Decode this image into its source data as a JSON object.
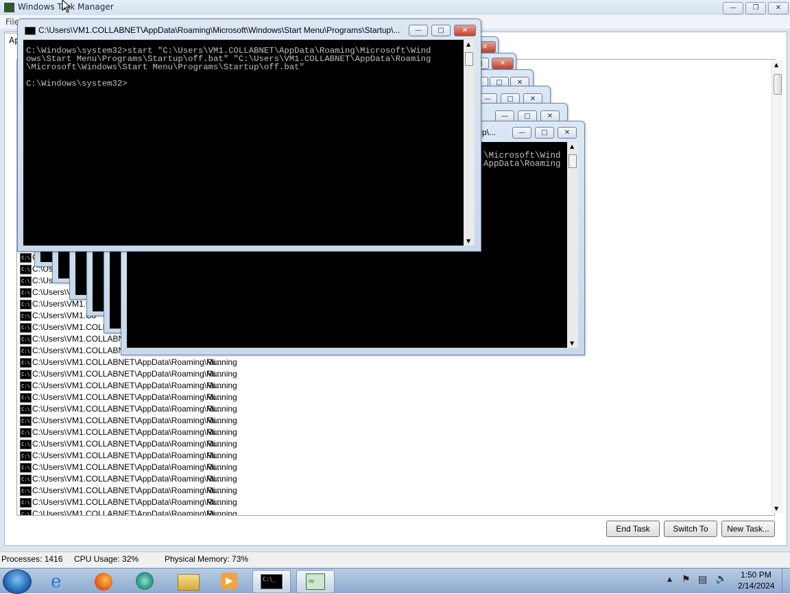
{
  "task_manager": {
    "title": "Windows Task Manager",
    "menu_file": "File",
    "tab_applications": "Ap",
    "buttons": {
      "end_task": "End Task",
      "switch_to": "Switch To",
      "new_task": "New Task..."
    },
    "status": {
      "processes": "Processes: 1416",
      "cpu": "CPU Usage: 32%",
      "memory": "Physical Memory: 73%"
    },
    "rows_partial": [
      "C",
      "C:\\Us",
      "C:\\Us",
      "C:\\Users\\Vi",
      "C:\\Users\\VM1.C",
      "C:\\Users\\VM1.Co",
      "C:\\Users\\VM1.COLLAE",
      "C:\\Users\\VM1.COLLABNE",
      "C:\\Users\\VM1.COLLABNET"
    ],
    "rows_full": [
      {
        "name": "C:\\Users\\VM1.COLLABNET\\AppData\\Roaming\\Mi...",
        "status": "Running"
      },
      {
        "name": "C:\\Users\\VM1.COLLABNET\\AppData\\Roaming\\Mi...",
        "status": "Running"
      },
      {
        "name": "C:\\Users\\VM1.COLLABNET\\AppData\\Roaming\\Mi...",
        "status": "Running"
      },
      {
        "name": "C:\\Users\\VM1.COLLABNET\\AppData\\Roaming\\Mi...",
        "status": "Running"
      },
      {
        "name": "C:\\Users\\VM1.COLLABNET\\AppData\\Roaming\\Mi...",
        "status": "Running"
      },
      {
        "name": "C:\\Users\\VM1.COLLABNET\\AppData\\Roaming\\Mi...",
        "status": "Running"
      },
      {
        "name": "C:\\Users\\VM1.COLLABNET\\AppData\\Roaming\\Mi...",
        "status": "Running"
      },
      {
        "name": "C:\\Users\\VM1.COLLABNET\\AppData\\Roaming\\Mi...",
        "status": "Running"
      },
      {
        "name": "C:\\Users\\VM1.COLLABNET\\AppData\\Roaming\\Mi...",
        "status": "Running"
      },
      {
        "name": "C:\\Users\\VM1.COLLABNET\\AppData\\Roaming\\Mi...",
        "status": "Running"
      },
      {
        "name": "C:\\Users\\VM1.COLLABNET\\AppData\\Roaming\\Mi...",
        "status": "Running"
      },
      {
        "name": "C:\\Users\\VM1.COLLABNET\\AppData\\Roaming\\Mi...",
        "status": "Running"
      },
      {
        "name": "C:\\Users\\VM1.COLLABNET\\AppData\\Roaming\\Mi...",
        "status": "Running"
      },
      {
        "name": "C:\\Users\\VM1.COLLABNET\\AppData\\Roaming\\Mi...",
        "status": "Running"
      }
    ]
  },
  "console_front": {
    "title": "C:\\Users\\VM1.COLLABNET\\AppData\\Roaming\\Microsoft\\Windows\\Start Menu\\Programs\\Startup\\...",
    "lines": [
      "C:\\Windows\\system32>start \"C:\\Users\\VM1.COLLABNET\\AppData\\Roaming\\Microsoft\\Wind",
      "ows\\Start Menu\\Programs\\Startup\\off.bat\" \"C:\\Users\\VM1.COLLABNET\\AppData\\Roaming",
      "\\Microsoft\\Windows\\Start Menu\\Programs\\Startup\\off.bat\"",
      "",
      "C:\\Windows\\system32>"
    ]
  },
  "console_back": {
    "title_fragment": "rtup\\...",
    "lines": [
      "\\Microsoft\\Wind",
      "AppData\\Roaming"
    ]
  },
  "taskbar": {
    "time": "1:50 PM",
    "date": "2/14/2024"
  }
}
